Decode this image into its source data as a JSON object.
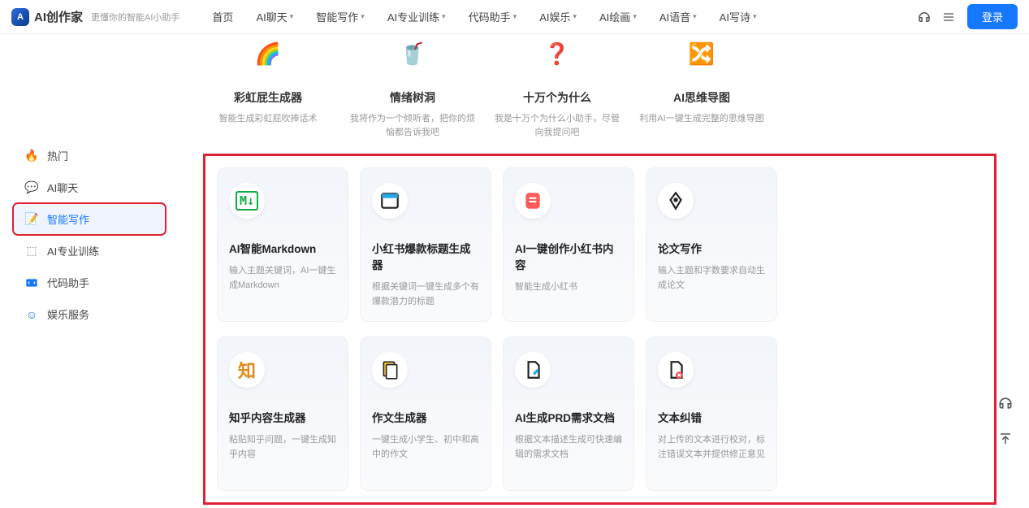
{
  "header": {
    "brand": "AI创作家",
    "slogan": "更懂你的智能AI小助手",
    "nav": [
      "首页",
      "AI聊天",
      "智能写作",
      "AI专业训练",
      "代码助手",
      "AI娱乐",
      "AI绘画",
      "AI语音",
      "AI写诗"
    ],
    "login": "登录"
  },
  "sidebar": {
    "items": [
      {
        "label": "热门"
      },
      {
        "label": "AI聊天"
      },
      {
        "label": "智能写作"
      },
      {
        "label": "AI专业训练"
      },
      {
        "label": "代码助手"
      },
      {
        "label": "娱乐服务"
      }
    ],
    "active_index": 2
  },
  "top_cards": [
    {
      "title": "彩虹屁生成器",
      "desc": "智能生成彩虹屁吹捧话术"
    },
    {
      "title": "情绪树洞",
      "desc": "我将作为一个倾听者，把你的烦恼都告诉我吧"
    },
    {
      "title": "十万个为什么",
      "desc": "我是十万个为什么小助手，尽管向我提问吧"
    },
    {
      "title": "AI思维导图",
      "desc": "利用AI一键生成完整的思维导图"
    }
  ],
  "cards": [
    {
      "title": "AI智能Markdown",
      "desc": "输入主题关键词，AI一键生成Markdown"
    },
    {
      "title": "小红书爆款标题生成器",
      "desc": "根据关键词一键生成多个有爆款潜力的标题"
    },
    {
      "title": "AI一键创作小红书内容",
      "desc": "智能生成小红书"
    },
    {
      "title": "论文写作",
      "desc": "输入主题和字数要求自动生成论文"
    },
    {
      "title": "知乎内容生成器",
      "desc": "粘贴知乎问题，一键生成知乎内容"
    },
    {
      "title": "作文生成器",
      "desc": "一键生成小学生、初中和高中的作文"
    },
    {
      "title": "AI生成PRD需求文档",
      "desc": "根据文本描述生成可快速编辑的需求文档"
    },
    {
      "title": "文本纠错",
      "desc": "对上传的文本进行校对，标注错误文本并提供修正意见"
    }
  ]
}
